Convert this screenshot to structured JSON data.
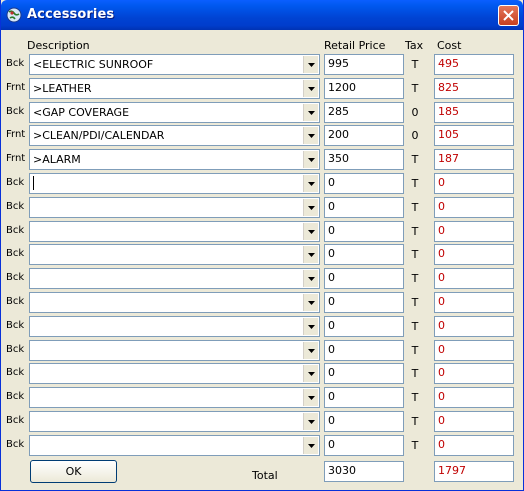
{
  "window": {
    "title": "Accessories"
  },
  "headers": {
    "description": "Description",
    "retail_price": "Retail Price",
    "tax": "Tax",
    "cost": "Cost"
  },
  "rows": [
    {
      "side": "Bck",
      "description": "<ELECTRIC SUNROOF",
      "price": "995",
      "tax": "T",
      "cost": "495"
    },
    {
      "side": "Frnt",
      "description": ">LEATHER",
      "price": "1200",
      "tax": "T",
      "cost": "825"
    },
    {
      "side": "Bck",
      "description": "<GAP COVERAGE",
      "price": "285",
      "tax": "0",
      "cost": "185"
    },
    {
      "side": "Frnt",
      "description": ">CLEAN/PDI/CALENDAR",
      "price": "200",
      "tax": "0",
      "cost": "105"
    },
    {
      "side": "Frnt",
      "description": ">ALARM",
      "price": "350",
      "tax": "T",
      "cost": "187"
    },
    {
      "side": "Bck",
      "description": "",
      "price": "0",
      "tax": "T",
      "cost": "0"
    },
    {
      "side": "Bck",
      "description": "",
      "price": "0",
      "tax": "T",
      "cost": "0"
    },
    {
      "side": "Bck",
      "description": "",
      "price": "0",
      "tax": "T",
      "cost": "0"
    },
    {
      "side": "Bck",
      "description": "",
      "price": "0",
      "tax": "T",
      "cost": "0"
    },
    {
      "side": "Bck",
      "description": "",
      "price": "0",
      "tax": "T",
      "cost": "0"
    },
    {
      "side": "Bck",
      "description": "",
      "price": "0",
      "tax": "T",
      "cost": "0"
    },
    {
      "side": "Bck",
      "description": "",
      "price": "0",
      "tax": "T",
      "cost": "0"
    },
    {
      "side": "Bck",
      "description": "",
      "price": "0",
      "tax": "T",
      "cost": "0"
    },
    {
      "side": "Bck",
      "description": "",
      "price": "0",
      "tax": "T",
      "cost": "0"
    },
    {
      "side": "Bck",
      "description": "",
      "price": "0",
      "tax": "T",
      "cost": "0"
    },
    {
      "side": "Bck",
      "description": "",
      "price": "0",
      "tax": "T",
      "cost": "0"
    },
    {
      "side": "Bck",
      "description": "",
      "price": "0",
      "tax": "T",
      "cost": "0"
    }
  ],
  "footer": {
    "ok_label": "OK",
    "total_label": "Total",
    "total_price": "3030",
    "total_cost": "1797"
  },
  "colors": {
    "cost_text": "#c00000",
    "titlebar": "#0054e3",
    "window_bg": "#ece9d8",
    "field_border": "#7f9db9"
  },
  "icons": {
    "app": "globe-icon",
    "close": "close-icon",
    "dropdown": "chevron-down-icon"
  }
}
